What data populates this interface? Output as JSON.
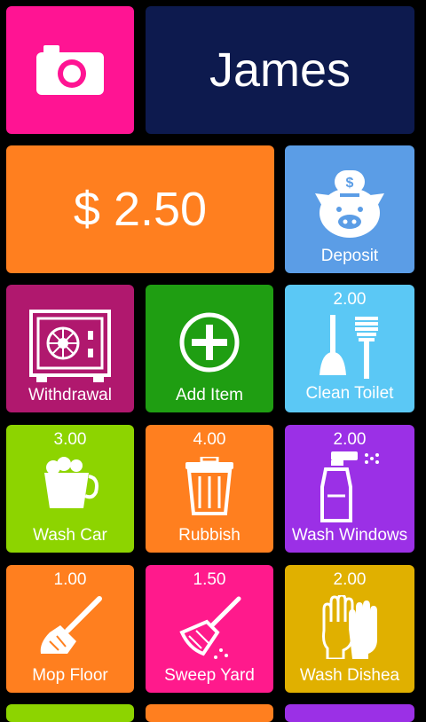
{
  "profile": {
    "name": "James"
  },
  "balance": {
    "amount_text": "$ 2.50"
  },
  "actions": {
    "deposit_label": "Deposit",
    "withdrawal_label": "Withdrawal",
    "add_item_label": "Add Item"
  },
  "chores": [
    {
      "amount": "2.00",
      "label": "Clean Toilet",
      "icon": "toilet-brush-icon",
      "color": "#5bc8f5"
    },
    {
      "amount": "3.00",
      "label": "Wash Car",
      "icon": "bucket-icon",
      "color": "#8dd400"
    },
    {
      "amount": "4.00",
      "label": "Rubbish",
      "icon": "trash-can-icon",
      "color": "#ff7f1f"
    },
    {
      "amount": "2.00",
      "label": "Wash Windows",
      "icon": "spray-bottle-icon",
      "color": "#9b30e6"
    },
    {
      "amount": "1.00",
      "label": "Mop Floor",
      "icon": "mop-icon",
      "color": "#ff7f1f"
    },
    {
      "amount": "1.50",
      "label": "Sweep Yard",
      "icon": "broom-icon",
      "color": "#ff1a8c"
    },
    {
      "amount": "2.00",
      "label": "Wash Dishea",
      "icon": "gloves-icon",
      "color": "#e0b000"
    }
  ],
  "colors": {
    "camera_tile": "#ff1493",
    "name_tile": "#0d1a4e",
    "balance_tile": "#ff7f1f",
    "deposit_tile": "#5b9de6",
    "withdrawal_tile": "#b0186e",
    "add_item_tile": "#1f9e12"
  }
}
